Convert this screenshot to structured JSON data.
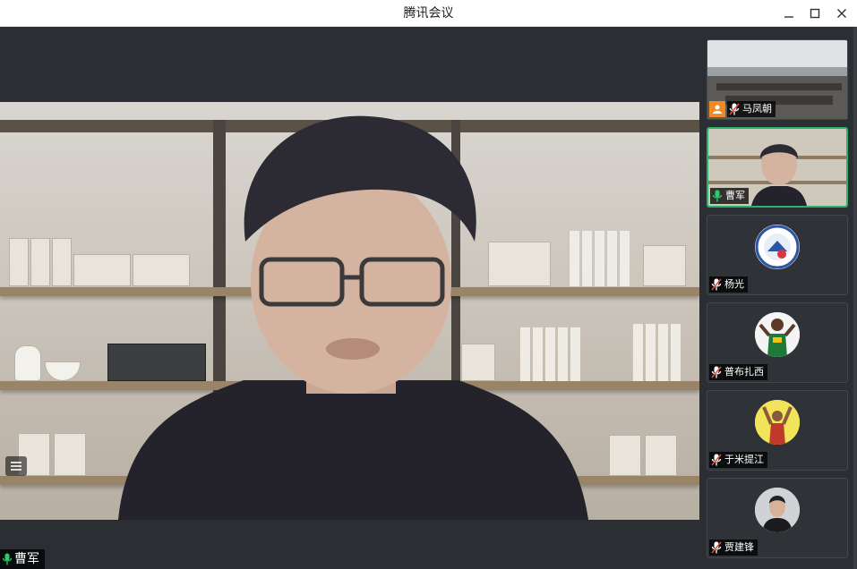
{
  "window": {
    "title": "腾讯会议",
    "minimize_label": "minimize",
    "maximize_label": "maximize",
    "close_label": "close"
  },
  "main_video": {
    "speaker_name": "曹军",
    "mic_status": "speaking"
  },
  "participants": [
    {
      "name": "马凤朝",
      "mic_status": "muted",
      "is_host": true,
      "video": "camera"
    },
    {
      "name": "曹军",
      "mic_status": "speaking",
      "is_host": false,
      "video": "camera",
      "active": true
    },
    {
      "name": "杨光",
      "mic_status": "muted",
      "is_host": false,
      "video": "avatar"
    },
    {
      "name": "普布扎西",
      "mic_status": "muted",
      "is_host": false,
      "video": "avatar"
    },
    {
      "name": "于米提江",
      "mic_status": "muted",
      "is_host": false,
      "video": "avatar"
    },
    {
      "name": "贾建锋",
      "mic_status": "muted",
      "is_host": false,
      "video": "avatar"
    }
  ],
  "colors": {
    "background": "#2b2e32",
    "active_border": "#29b36a",
    "host_badge": "#f08a24",
    "mic_speaking": "#2ecc71",
    "mic_muted": "#ffffff"
  }
}
